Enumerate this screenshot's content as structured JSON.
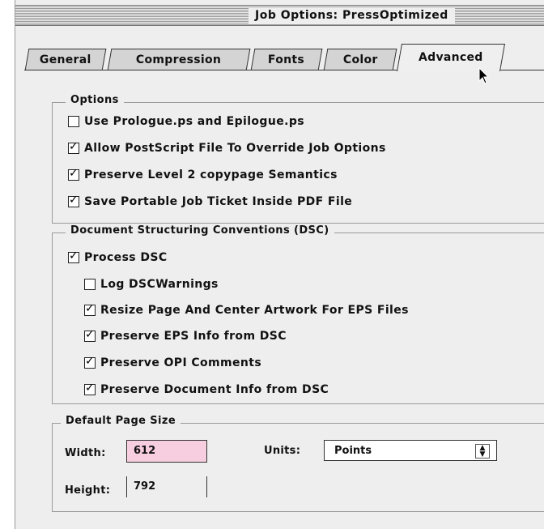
{
  "window": {
    "title": "Job Options: PressOptimized"
  },
  "tabs": [
    {
      "label": "General"
    },
    {
      "label": "Compression"
    },
    {
      "label": "Fonts"
    },
    {
      "label": "Color"
    },
    {
      "label": "Advanced"
    }
  ],
  "active_tab": "Advanced",
  "options": {
    "legend": "Options",
    "items": [
      {
        "label": "Use Prologue.ps and Epilogue.ps",
        "checked": false
      },
      {
        "label": "Allow PostScript File To Override Job Options",
        "checked": true
      },
      {
        "label": "Preserve Level 2 copypage Semantics",
        "checked": true
      },
      {
        "label": "Save Portable Job Ticket Inside PDF File",
        "checked": true
      }
    ]
  },
  "dsc": {
    "legend": "Document Structuring Conventions (DSC)",
    "process": {
      "label": "Process DSC",
      "checked": true
    },
    "items": [
      {
        "label": "Log DSCWarnings",
        "checked": false
      },
      {
        "label": "Resize Page And Center Artwork For EPS Files",
        "checked": true
      },
      {
        "label": "Preserve EPS Info from DSC",
        "checked": true
      },
      {
        "label": "Preserve OPI Comments",
        "checked": true
      },
      {
        "label": "Preserve Document Info from DSC",
        "checked": true
      }
    ]
  },
  "page_size": {
    "legend": "Default Page Size",
    "width_label": "Width:",
    "width_value": "612",
    "height_label": "Height:",
    "height_value": "792",
    "units_label": "Units:",
    "units_value": "Points"
  },
  "colors": {
    "window_bg": "#eeeeee",
    "width_field_bg": "#f7cde0"
  }
}
